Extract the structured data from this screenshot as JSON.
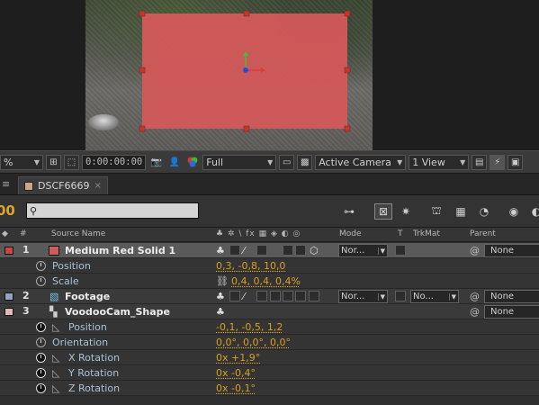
{
  "viewer": {
    "zoom": "%",
    "timecode": "0:00:00:00",
    "resolution": "Full",
    "camera": "Active Camera",
    "views": "1 View"
  },
  "timeline": {
    "tab_label": "DSCF6669",
    "tab_close": "×",
    "current_time_fragment": "00",
    "search_placeholder": "",
    "columns": {
      "source_name": "Source Name",
      "switches": "♣ ✲ \\ fx ▦ ◈ ◐ ◎",
      "mode": "Mode",
      "t": "T",
      "trkmat": "TrkMat",
      "parent": "Parent"
    },
    "layers": [
      {
        "num": "1",
        "name": "Medium Red Solid 1",
        "color": "#c84646",
        "mode": "Nor...",
        "parent": "None",
        "props": [
          {
            "name": "Position",
            "value": "0,3, -0,8, 10,0"
          },
          {
            "name": "Scale",
            "value": "0,4, 0,4, 0,4%"
          }
        ]
      },
      {
        "num": "2",
        "name": "Footage",
        "color": "#8ea6c4",
        "mode": "Nor...",
        "trkmat": "No...",
        "parent": "None"
      },
      {
        "num": "3",
        "name": "VoodooCam_Shape",
        "color": "#e0b9b9",
        "parent": "None",
        "props": [
          {
            "name": "Position",
            "value": "-0,1, -0,5, 1,2"
          },
          {
            "name": "Orientation",
            "value": "0,0°, 0,0°, 0,0°"
          },
          {
            "name": "X Rotation",
            "value": "0x +1,9°"
          },
          {
            "name": "Y Rotation",
            "value": "0x -0,4°"
          },
          {
            "name": "Z Rotation",
            "value": "0x -0,1°"
          }
        ]
      }
    ]
  },
  "colors": {
    "accent_orange": "#e0a526",
    "solid_red": "#d15a5a",
    "selection": "#5a5a5a"
  }
}
